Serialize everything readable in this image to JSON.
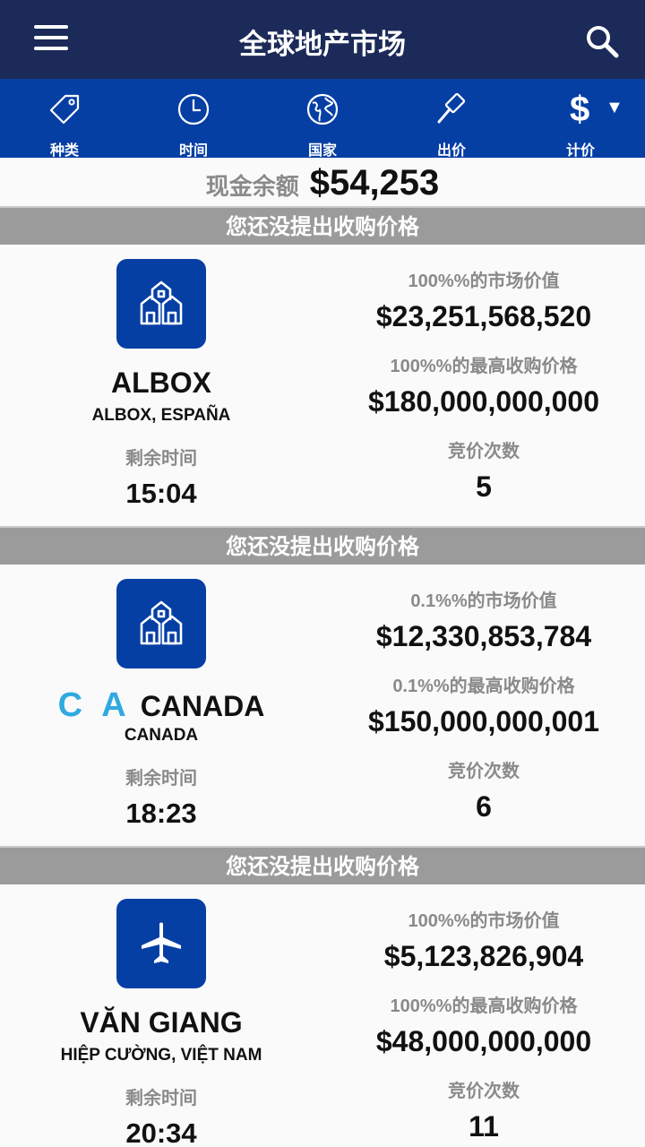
{
  "header": {
    "title": "全球地产市场"
  },
  "tabs": [
    {
      "label": "种类",
      "icon": "tag-icon"
    },
    {
      "label": "时间",
      "icon": "clock-icon"
    },
    {
      "label": "国家",
      "icon": "globe-icon"
    },
    {
      "label": "出价",
      "icon": "gavel-icon"
    },
    {
      "label": "计价",
      "icon": "dollar-icon",
      "symbol": "$",
      "caret": "▼"
    }
  ],
  "balance": {
    "label": "现金余额",
    "value": "$54,253"
  },
  "listings": [
    {
      "banner": "您还没提出收购价格",
      "icon": "buildings-icon",
      "flag": "",
      "name": "ALBOX",
      "location": "ALBOX, ESPAÑA",
      "time_label": "剩余时间",
      "time_value": "15:04",
      "market_label": "100%%的市场价值",
      "market_value": "$23,251,568,520",
      "bid_label": "100%%的最高收购价格",
      "bid_value": "$180,000,000,000",
      "count_label": "竞价次数",
      "count_value": "5"
    },
    {
      "banner": "您还没提出收购价格",
      "icon": "buildings-icon",
      "flag": "C A",
      "name": "CANADA",
      "location": "CANADA",
      "time_label": "剩余时间",
      "time_value": "18:23",
      "market_label": "0.1%%的市场价值",
      "market_value": "$12,330,853,784",
      "bid_label": "0.1%%的最高收购价格",
      "bid_value": "$150,000,000,001",
      "count_label": "竞价次数",
      "count_value": "6"
    },
    {
      "banner": "您还没提出收购价格",
      "icon": "airplane-icon",
      "flag": "",
      "name": "VĂN GIANG",
      "location": "HIỆP CƯỜNG, VIỆT NAM",
      "time_label": "剩余时间",
      "time_value": "20:34",
      "market_label": "100%%的市场价值",
      "market_value": "$5,123,826,904",
      "bid_label": "100%%的最高收购价格",
      "bid_value": "$48,000,000,000",
      "count_label": "竞价次数",
      "count_value": "11"
    }
  ],
  "colors": {
    "header": "#1b2a58",
    "tabbar": "#063fa4",
    "accent": "#063fa4",
    "banner": "#9b9b9b",
    "flag": "#2fa9e0"
  }
}
